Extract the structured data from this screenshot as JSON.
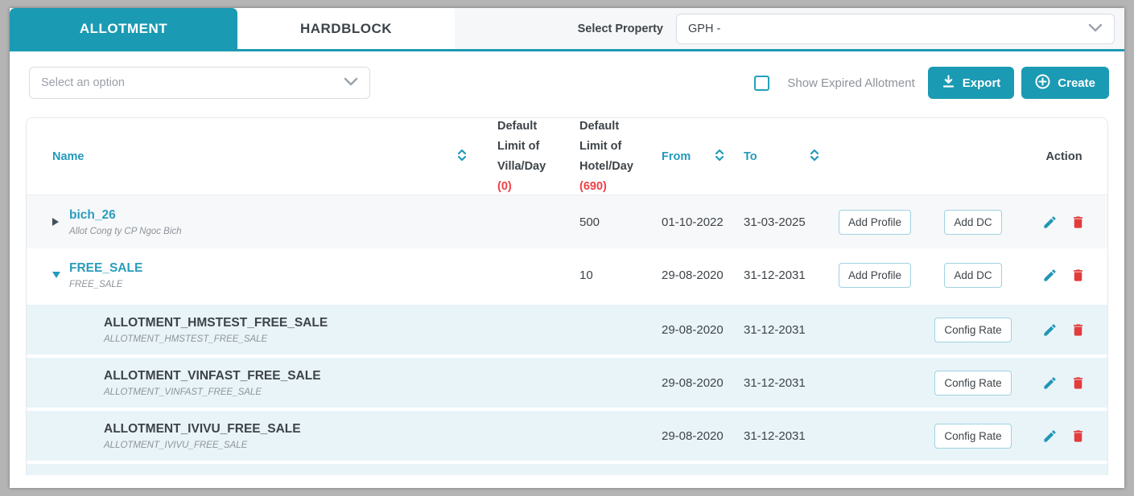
{
  "tabs": [
    {
      "label": "ALLOTMENT",
      "active": true
    },
    {
      "label": "HARDBLOCK",
      "active": false
    }
  ],
  "property_selector": {
    "label": "Select Property",
    "value": "GPH -"
  },
  "filter_dropdown": {
    "placeholder": "Select an option"
  },
  "toolbar": {
    "show_expired_label": "Show Expired Allotment",
    "show_expired_checked": false,
    "export_label": "Export",
    "create_label": "Create"
  },
  "table": {
    "header": {
      "name": "Name",
      "villa_line1": "Default Limit of",
      "villa_line2": "Villa/Day",
      "villa_count": "(0)",
      "hotel_line1": "Default Limit of",
      "hotel_line2": "Hotel/Day",
      "hotel_count": "(690)",
      "from": "From",
      "to": "To",
      "action": "Action"
    },
    "rows": [
      {
        "type": "parent",
        "expanded": false,
        "name": "bich_26",
        "subtitle": "Allot Cong ty CP Ngoc Bich",
        "hotel_limit": "500",
        "from": "01-10-2022",
        "to": "31-03-2025",
        "button1": "Add Profile",
        "button2": "Add DC"
      },
      {
        "type": "parent",
        "expanded": true,
        "name": "FREE_SALE",
        "subtitle": "FREE_SALE",
        "hotel_limit": "10",
        "from": "29-08-2020",
        "to": "31-12-2031",
        "button1": "Add Profile",
        "button2": "Add DC"
      },
      {
        "type": "child",
        "name": "ALLOTMENT_HMSTEST_FREE_SALE",
        "subtitle": "ALLOTMENT_HMSTEST_FREE_SALE",
        "from": "29-08-2020",
        "to": "31-12-2031",
        "button2": "Config Rate"
      },
      {
        "type": "child",
        "name": "ALLOTMENT_VINFAST_FREE_SALE",
        "subtitle": "ALLOTMENT_VINFAST_FREE_SALE",
        "from": "29-08-2020",
        "to": "31-12-2031",
        "button2": "Config Rate"
      },
      {
        "type": "child",
        "name": "ALLOTMENT_IVIVU_FREE_SALE",
        "subtitle": "ALLOTMENT_IVIVU_FREE_SALE",
        "from": "29-08-2020",
        "to": "31-12-2031",
        "button2": "Config Rate"
      }
    ]
  },
  "icons": {
    "export": "download-icon",
    "create": "plus-circle-icon",
    "edit": "pencil-icon",
    "delete": "trash-icon",
    "sort": "sort-chevrons-icon",
    "select": "chevron-down-icon"
  },
  "colors": {
    "accent_teal": "#1b9ab3",
    "link_teal": "#2b9cbe",
    "danger_red": "#e23c3c",
    "count_red": "#ee4147",
    "text_dark": "#3d4449",
    "text_muted": "#8d949b",
    "child_row_bg": "#e9f4f9",
    "alt_row_bg": "#f7f8f9"
  }
}
